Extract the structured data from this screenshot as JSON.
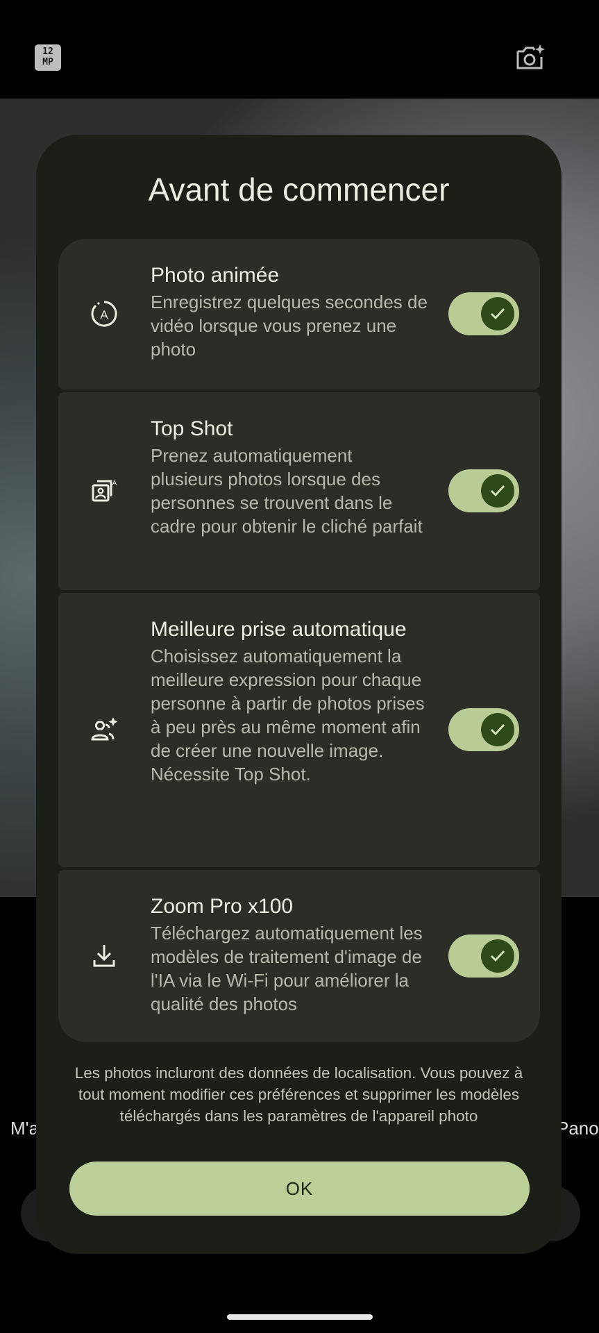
{
  "camera": {
    "mp_badge": "12\nMP",
    "mode_left": "M'a",
    "mode_right": "Pano"
  },
  "dialog": {
    "title": "Avant de commencer",
    "options": [
      {
        "title": "Photo animée",
        "description": "Enregistrez quelques secondes de vidéo lorsque vous prenez une photo",
        "icon": "motion-photo-icon",
        "enabled": true
      },
      {
        "title": "Top Shot",
        "description": "Prenez automatiquement plusieurs photos lorsque des personnes se trouvent dans le cadre pour obtenir le cliché parfait",
        "icon": "top-shot-icon",
        "enabled": true
      },
      {
        "title": "Meilleure prise automatique",
        "description": "Choisissez automatiquement la meilleure expression pour chaque personne à partir de photos prises à peu près au même moment afin de créer une nouvelle image. Nécessite Top Shot.",
        "icon": "best-take-icon",
        "enabled": true
      },
      {
        "title": "Zoom Pro x100",
        "description": "Téléchargez automatiquement les modèles de traitement d'image de l'IA via le Wi-Fi pour améliorer la qualité des photos",
        "icon": "download-icon",
        "enabled": true
      }
    ],
    "footnote": "Les photos incluront des données de localisation. Vous pouvez à tout moment modifier ces préférences et supprimer les modèles téléchargés dans les paramètres de l'appareil photo",
    "ok_label": "OK"
  },
  "colors": {
    "dialog_bg": "#1c1e18",
    "card_bg": "#2c2d27",
    "toggle_track": "#b9cc95",
    "toggle_knob": "#2e4a18",
    "ok_bg": "#bccf98"
  }
}
